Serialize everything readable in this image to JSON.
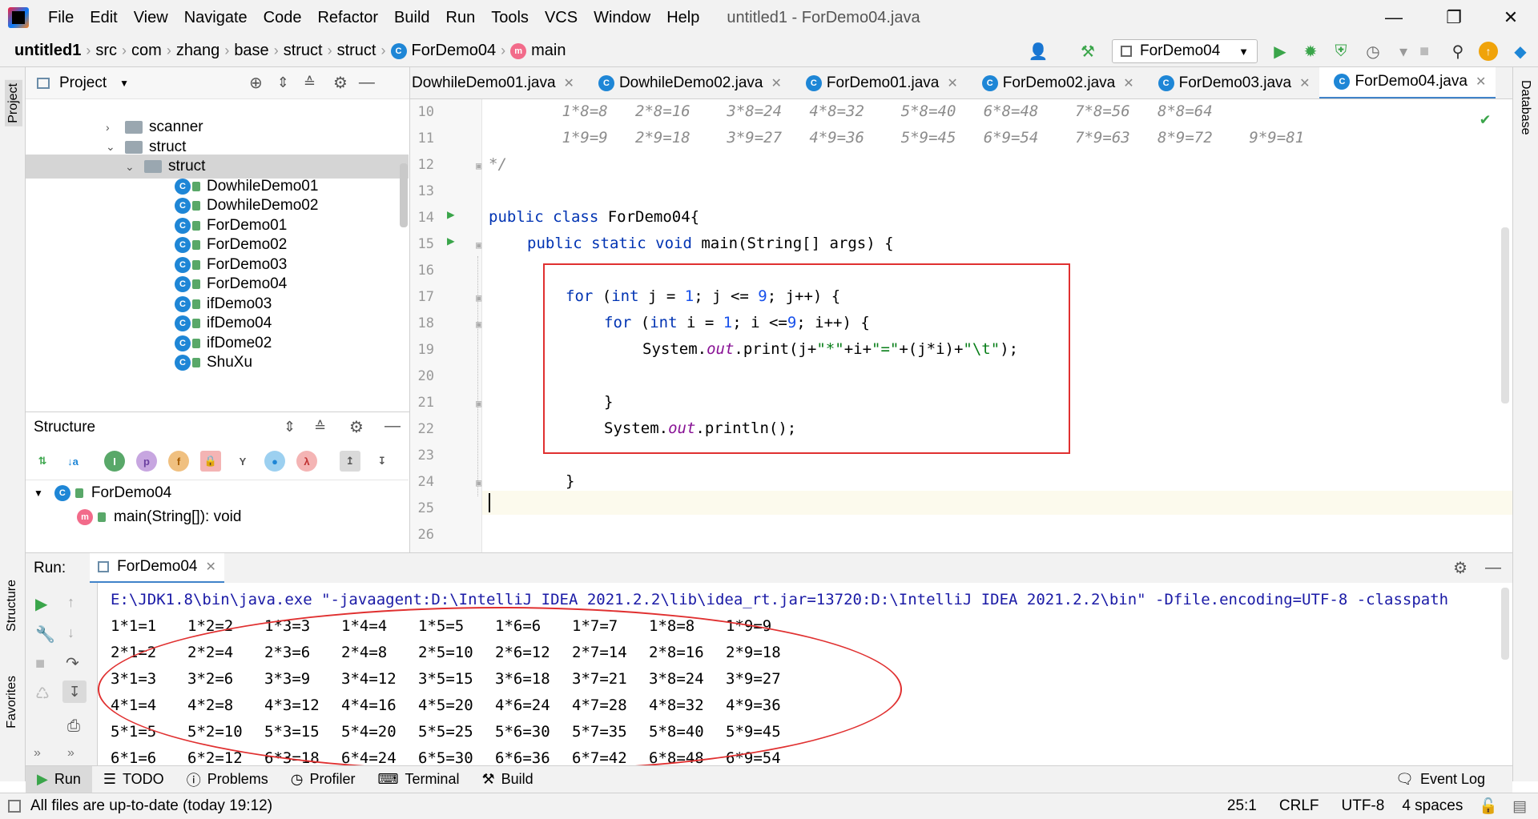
{
  "menu": [
    "File",
    "Edit",
    "View",
    "Navigate",
    "Code",
    "Refactor",
    "Build",
    "Run",
    "Tools",
    "VCS",
    "Window",
    "Help"
  ],
  "window_title": "untitled1 - ForDemo04.java",
  "breadcrumb": [
    "untitled1",
    "src",
    "com",
    "zhang",
    "base",
    "struct",
    "struct",
    "ForDemo04",
    "main"
  ],
  "run_config": "ForDemo04",
  "project_panel": {
    "title": "Project",
    "tree": [
      {
        "label": "scanner",
        "type": "folder",
        "depth": 1,
        "expanded": false
      },
      {
        "label": "struct",
        "type": "folder",
        "depth": 1,
        "expanded": true
      },
      {
        "label": "struct",
        "type": "folder",
        "depth": 2,
        "expanded": true,
        "selected": true
      },
      {
        "label": "DowhileDemo01",
        "type": "class",
        "depth": 3
      },
      {
        "label": "DowhileDemo02",
        "type": "class",
        "depth": 3
      },
      {
        "label": "ForDemo01",
        "type": "class",
        "depth": 3
      },
      {
        "label": "ForDemo02",
        "type": "class",
        "depth": 3
      },
      {
        "label": "ForDemo03",
        "type": "class",
        "depth": 3
      },
      {
        "label": "ForDemo04",
        "type": "class",
        "depth": 3
      },
      {
        "label": "ifDemo03",
        "type": "class",
        "depth": 3
      },
      {
        "label": "ifDemo04",
        "type": "class",
        "depth": 3
      },
      {
        "label": "ifDome02",
        "type": "class",
        "depth": 3
      },
      {
        "label": "ShuXu",
        "type": "class",
        "depth": 3
      }
    ]
  },
  "structure_panel": {
    "title": "Structure",
    "items": [
      {
        "label": "ForDemo04",
        "icon": "c"
      },
      {
        "label": "main(String[]): void",
        "icon": "m"
      }
    ]
  },
  "tabs": [
    {
      "label": "DowhileDemo01.java",
      "active": false
    },
    {
      "label": "DowhileDemo02.java",
      "active": false
    },
    {
      "label": "ForDemo01.java",
      "active": false
    },
    {
      "label": "ForDemo02.java",
      "active": false
    },
    {
      "label": "ForDemo03.java",
      "active": false
    },
    {
      "label": "ForDemo04.java",
      "active": true
    }
  ],
  "editor": {
    "line_numbers": [
      "10",
      "11",
      "12",
      "13",
      "14",
      "15",
      "16",
      "17",
      "18",
      "19",
      "20",
      "21",
      "22",
      "23",
      "24",
      "25",
      "26"
    ],
    "comment_line_10": "        1*8=8   2*8=16    3*8=24   4*8=32    5*8=40   6*8=48    7*8=56   8*8=64",
    "comment_line_11": "        1*9=9   2*9=18    3*9=27   4*9=36    5*9=45   6*9=54    7*9=63   8*9=72    9*9=81",
    "comment_end": "*/",
    "l14_kw": "public class",
    "l14_rest": " ForDemo04{",
    "l15_kw": "public static void",
    "l15_rest": " main(String[] args) {",
    "l17_for": "for",
    "l17_int": "int",
    "l17_a": " (",
    "l17_b": " j = ",
    "l17_n1": "1",
    "l17_c": "; j <= ",
    "l17_n9": "9",
    "l17_d": "; j++) {",
    "l18_for": "for",
    "l18_int": "int",
    "l18_a": " (",
    "l18_b": " i = ",
    "l18_n1": "1",
    "l18_c": "; i <=",
    "l18_n9": "9",
    "l18_d": "; i++) {",
    "l19_a": "System.",
    "l19_out": "out",
    "l19_b": ".print(j+",
    "l19_s1": "\"*\"",
    "l19_c": "+i+",
    "l19_s2": "\"=\"",
    "l19_d": "+(j*i)+",
    "l19_s3": "\"\\t\"",
    "l19_e": ");",
    "l21": "}",
    "l22_a": "System.",
    "l22_out": "out",
    "l22_b": ".println();",
    "l24": "}"
  },
  "run_panel": {
    "label": "Run:",
    "tab": "ForDemo04",
    "command": "E:\\JDK1.8\\bin\\java.exe \"-javaagent:D:\\IntelliJ IDEA 2021.2.2\\lib\\idea_rt.jar=13720:D:\\IntelliJ IDEA 2021.2.2\\bin\" -Dfile.encoding=UTF-8 -classpath",
    "rows": [
      [
        "1*1=1",
        "1*2=2",
        "1*3=3",
        "1*4=4",
        "1*5=5",
        "1*6=6",
        "1*7=7",
        "1*8=8",
        "1*9=9"
      ],
      [
        "2*1=2",
        "2*2=4",
        "2*3=6",
        "2*4=8",
        "2*5=10",
        "2*6=12",
        "2*7=14",
        "2*8=16",
        "2*9=18"
      ],
      [
        "3*1=3",
        "3*2=6",
        "3*3=9",
        "3*4=12",
        "3*5=15",
        "3*6=18",
        "3*7=21",
        "3*8=24",
        "3*9=27"
      ],
      [
        "4*1=4",
        "4*2=8",
        "4*3=12",
        "4*4=16",
        "4*5=20",
        "4*6=24",
        "4*7=28",
        "4*8=32",
        "4*9=36"
      ],
      [
        "5*1=5",
        "5*2=10",
        "5*3=15",
        "5*4=20",
        "5*5=25",
        "5*6=30",
        "5*7=35",
        "5*8=40",
        "5*9=45"
      ],
      [
        "6*1=6",
        "6*2=12",
        "6*3=18",
        "6*4=24",
        "6*5=30",
        "6*6=36",
        "6*7=42",
        "6*8=48",
        "6*9=54"
      ]
    ]
  },
  "bottom_tabs": [
    "Run",
    "TODO",
    "Problems",
    "Profiler",
    "Terminal",
    "Build"
  ],
  "event_log": "Event Log",
  "left_strip": {
    "project": "Project",
    "structure": "Structure",
    "favorites": "Favorites"
  },
  "right_strip": {
    "database": "Database"
  },
  "status": {
    "message": "All files are up-to-date (today 19:12)",
    "position": "25:1",
    "line_sep": "CRLF",
    "encoding": "UTF-8",
    "indent": "4 spaces"
  },
  "colors": {
    "accent": "#4083c9",
    "annotation": "#e03030",
    "run_green": "#3aa54a"
  }
}
